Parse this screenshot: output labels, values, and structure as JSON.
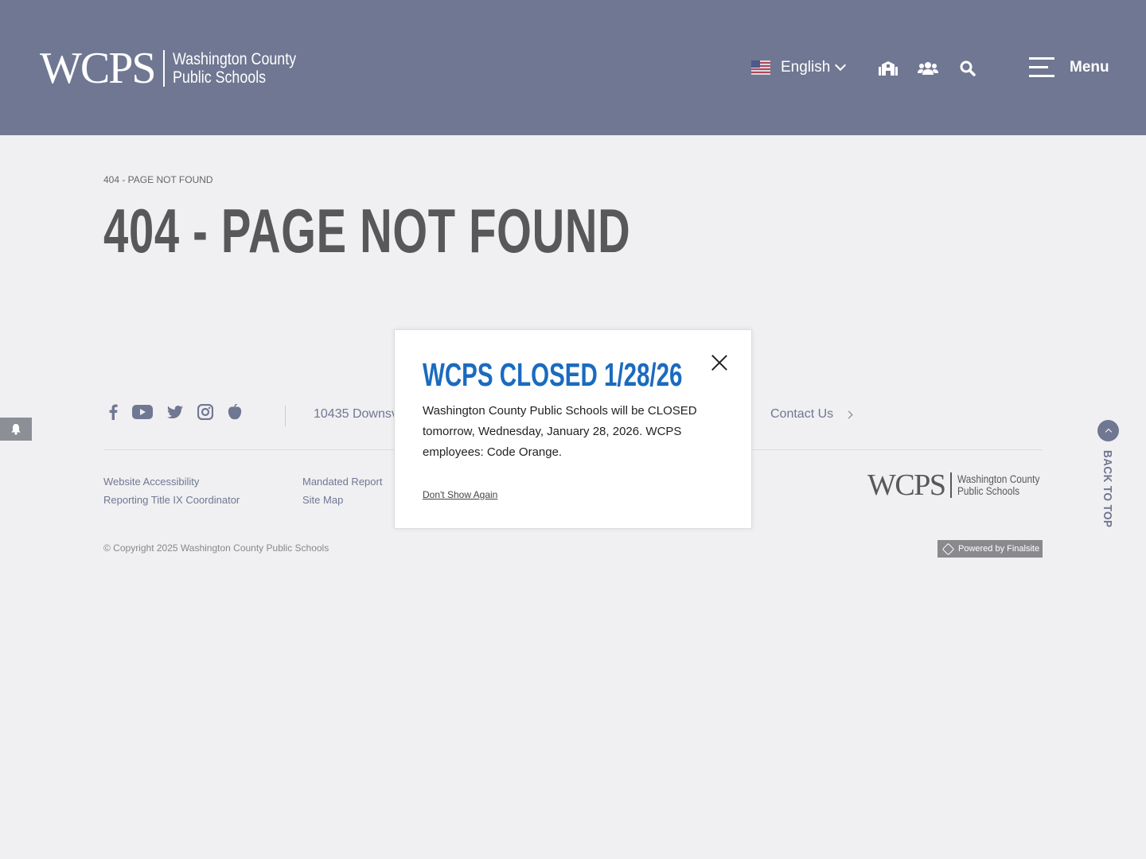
{
  "header": {
    "logo_mark": "WCPS",
    "logo_line1": "Washington County",
    "logo_line2": "Public Schools",
    "language": "English",
    "icons": [
      "schools-icon",
      "users-icon",
      "search-icon"
    ],
    "menu_label": "Menu",
    "background": "#707792"
  },
  "main": {
    "breadcrumb": "404 - PAGE NOT FOUND",
    "title": "404 - PAGE NOT FOUND"
  },
  "footer": {
    "social": [
      "facebook-icon",
      "youtube-icon",
      "twitter-icon",
      "instagram-icon",
      "peachjar-icon"
    ],
    "address": "10435 Downsv",
    "contact": "Contact Us",
    "links_col1": [
      "Website Accessibility",
      "Reporting Title IX Coordinator"
    ],
    "links_col2": [
      "Mandated Report",
      "Site Map"
    ],
    "copyright": "© Copyright 2025 Washington County Public Schools",
    "powered": "Powered by Finalsite",
    "back_to_top": "BACK TO TOP"
  },
  "modal": {
    "title": "WCPS CLOSED 1/28/26",
    "body": "Washington County Public Schools will be CLOSED tomorrow, Wednesday, January 28, 2026. WCPS employees: Code Orange.",
    "dismiss": "Don't Show Again",
    "accent": "#1a6bbf"
  }
}
